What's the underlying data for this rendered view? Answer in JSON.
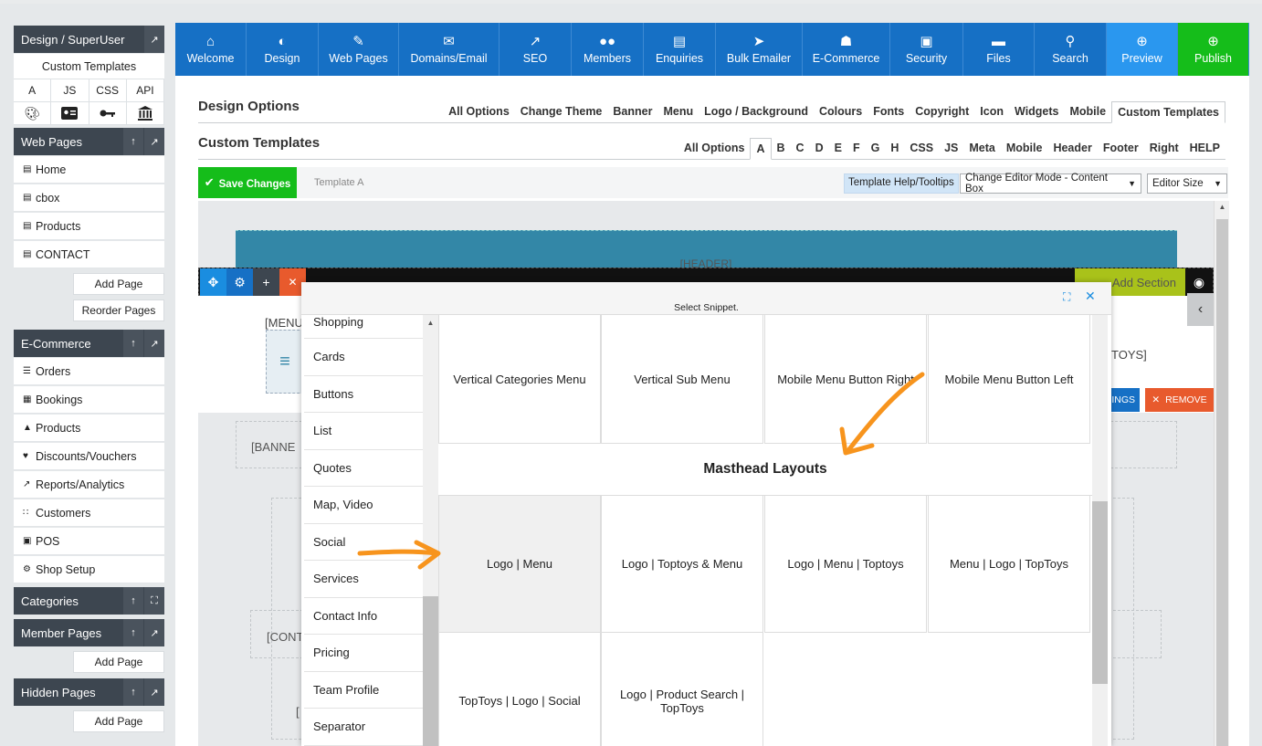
{
  "sidebar": {
    "design_title": "Design / SuperUser",
    "custom_templates": "Custom Templates",
    "code_links": [
      "A",
      "JS",
      "CSS",
      "API"
    ],
    "icon_links": [
      "palette-icon",
      "id-card-icon",
      "key-icon",
      "bank-icon"
    ],
    "web_pages": {
      "title": "Web Pages",
      "items": [
        "Home",
        "cbox",
        "Products",
        "CONTACT"
      ],
      "add_page": "Add Page",
      "reorder_pages": "Reorder Pages"
    },
    "ecommerce": {
      "title": "E-Commerce",
      "items": [
        "Orders",
        "Bookings",
        "Products",
        "Discounts/Vouchers",
        "Reports/Analytics",
        "Customers",
        "POS",
        "Shop Setup"
      ]
    },
    "categories": {
      "title": "Categories"
    },
    "member_pages": {
      "title": "Member Pages",
      "add_page": "Add Page"
    },
    "hidden_pages": {
      "title": "Hidden Pages",
      "add_page": "Add Page"
    }
  },
  "nav": {
    "items": [
      "Welcome",
      "Design",
      "Web Pages",
      "Domains/Email",
      "SEO",
      "Members",
      "Enquiries",
      "Bulk Emailer",
      "E-Commerce",
      "Security",
      "Files",
      "Search",
      "Preview",
      "Publish"
    ],
    "colors": {
      "default": "#1670c5",
      "preview": "#2a97ef",
      "publish": "#15bd1a"
    }
  },
  "design_options": {
    "title": "Design Options",
    "tabs": [
      "All Options",
      "Change Theme",
      "Banner",
      "Menu",
      "Logo / Background",
      "Colours",
      "Fonts",
      "Copyright",
      "Icon",
      "Widgets",
      "Mobile",
      "Custom Templates"
    ],
    "active_tab": "Custom Templates"
  },
  "custom_templates": {
    "title": "Custom Templates",
    "tabs": [
      "All Options",
      "A",
      "B",
      "C",
      "D",
      "E",
      "F",
      "G",
      "H",
      "CSS",
      "JS",
      "Meta",
      "Mobile",
      "Header",
      "Footer",
      "Right",
      "HELP"
    ],
    "active_tab": "A"
  },
  "toolbar": {
    "save_label": "Save Changes",
    "template_label": "Template A",
    "help_label": "Template Help/Tooltips",
    "editor_mode": "Change Editor Mode - Content Box",
    "editor_size": "Editor Size"
  },
  "canvas": {
    "header_label": "[HEADER]",
    "add_section": "Add Section",
    "menu_label": "[MENU",
    "toys_label": "TOYS]",
    "settings_label": "TINGS",
    "remove_label": "REMOVE",
    "banner_label": "[BANNE",
    "contact_label": "[CONT",
    "bracket_label": "["
  },
  "snippet_modal": {
    "title": "Select Snippet.",
    "categories": [
      "Shopping",
      "Cards",
      "Buttons",
      "List",
      "Quotes",
      "Map, Video",
      "Social",
      "Services",
      "Contact Info",
      "Pricing",
      "Team Profile",
      "Separator"
    ],
    "menu_row": [
      "Vertical Categories Menu",
      "Vertical Sub Menu",
      "Mobile Menu Button Right",
      "Mobile Menu Button Left"
    ],
    "section_heading": "Masthead Layouts",
    "masthead_row1": [
      "Logo | Menu",
      "Logo | Toptoys & Menu",
      "Logo | Menu | Toptoys",
      "Menu | Logo | TopToys"
    ],
    "masthead_row2": [
      "TopToys | Logo | Social",
      "Logo | Product Search | TopToys"
    ]
  },
  "annotation_color": "#f7941d"
}
